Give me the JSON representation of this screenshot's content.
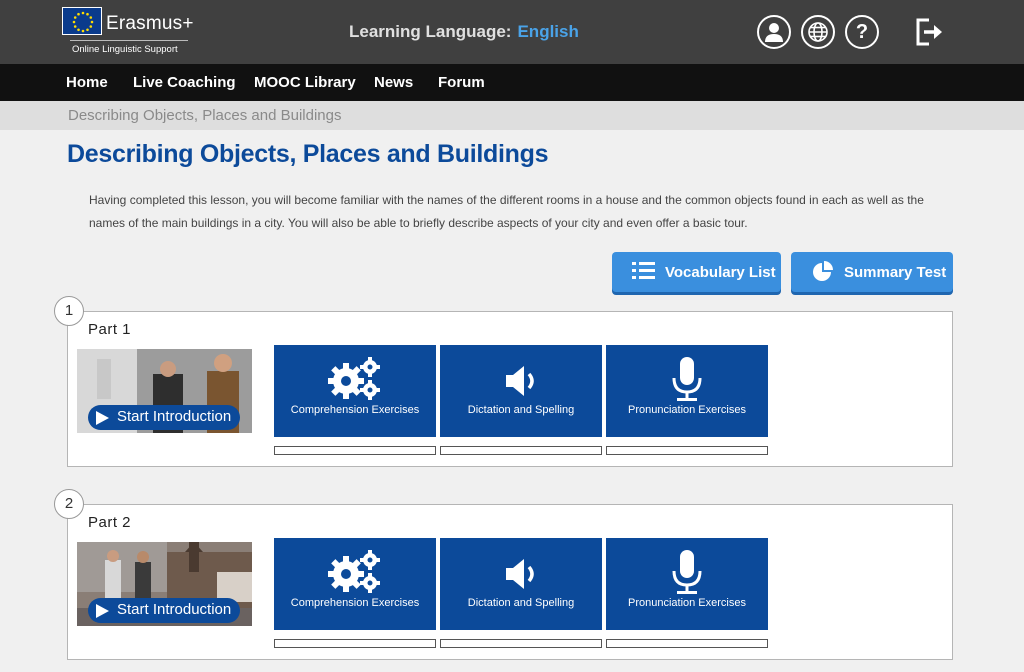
{
  "header": {
    "logo_name": "Erasmus+",
    "logo_tagline": "Online Linguistic Support",
    "learning_language_label": "Learning Language:",
    "learning_language_value": "English",
    "icons": [
      "user-icon",
      "globe-icon",
      "help-icon",
      "logout-icon"
    ],
    "help_glyph": "?"
  },
  "nav": {
    "items": [
      "Home",
      "Live Coaching",
      "MOOC Library",
      "News",
      "Forum"
    ]
  },
  "breadcrumb": "Describing Objects, Places and Buildings",
  "page": {
    "title": "Describing Objects, Places and Buildings",
    "description": "Having completed this lesson, you will become familiar with the names of the different rooms in a house and the common objects found in each as well as the names of the main buildings in a city. You will also be able to briefly describe aspects of your city and even offer a basic tour."
  },
  "actions": {
    "vocabulary_label": "Vocabulary List",
    "summary_label": "Summary Test"
  },
  "parts": [
    {
      "number": "1",
      "title": "Part 1",
      "start_label": "Start Introduction",
      "activities": [
        {
          "label": "Comprehension Exercises",
          "icon": "gears-icon",
          "progress": 0
        },
        {
          "label": "Dictation and Spelling",
          "icon": "speaker-icon",
          "progress": 0
        },
        {
          "label": "Pronunciation Exercises",
          "icon": "microphone-icon",
          "progress": 0
        }
      ]
    },
    {
      "number": "2",
      "title": "Part 2",
      "start_label": "Start Introduction",
      "activities": [
        {
          "label": "Comprehension Exercises",
          "icon": "gears-icon",
          "progress": 0
        },
        {
          "label": "Dictation and Spelling",
          "icon": "speaker-icon",
          "progress": 0
        },
        {
          "label": "Pronunciation Exercises",
          "icon": "microphone-icon",
          "progress": 0
        }
      ]
    }
  ],
  "colors": {
    "brand_blue": "#0c4a9a",
    "button_blue": "#3a8fde",
    "topbar": "#404040",
    "navbar": "#111111",
    "language_accent": "#4aa3e8"
  }
}
